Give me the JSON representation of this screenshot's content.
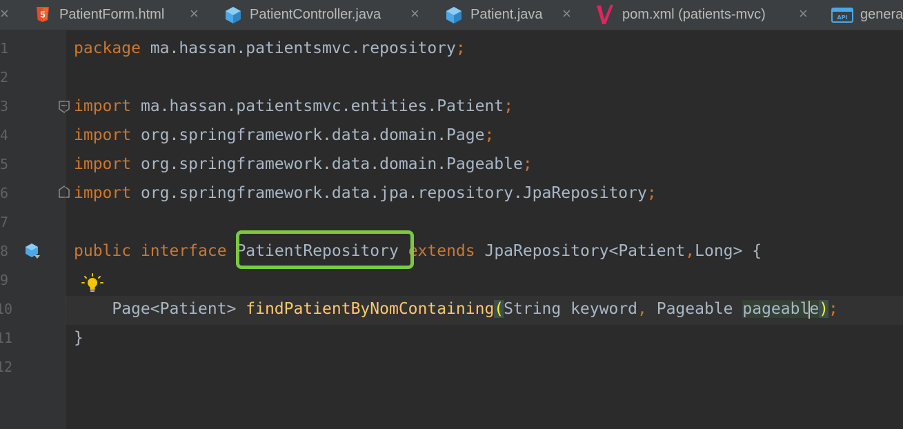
{
  "tabs": [
    {
      "label": "PatientForm.html",
      "icon": "html5-icon",
      "color": "#e44d26"
    },
    {
      "label": "PatientController.java",
      "icon": "java-class-icon",
      "color": "#4aa8e8"
    },
    {
      "label": "Patient.java",
      "icon": "java-class-icon",
      "color": "#4aa8e8"
    },
    {
      "label": "pom.xml (patients-mvc)",
      "icon": "maven-icon",
      "color": "#e0245e"
    },
    {
      "label": "genera",
      "icon": "api-file-icon",
      "color": "#4aa8e8"
    }
  ],
  "editor": {
    "line_numbers": [
      "1",
      "2",
      "3",
      "4",
      "5",
      "6",
      "7",
      "8",
      "9",
      "10",
      "11",
      "12"
    ],
    "code": {
      "l1_kw": "package",
      "l1_rest": " ma.hassan.patientsmvc.repository",
      "l1_semi": ";",
      "l3_kw": "import",
      "l3_rest": " ma.hassan.patientsmvc.entities.Patient",
      "l3_semi": ";",
      "l4_kw": "import",
      "l4_rest": " org.springframework.data.domain.Page",
      "l4_semi": ";",
      "l5_kw": "import",
      "l5_rest": " org.springframework.data.domain.Pageable",
      "l5_semi": ";",
      "l6_kw": "import",
      "l6_rest": " org.springframework.data.jpa.repository.JpaRepository",
      "l6_semi": ";",
      "l8_kw1": "public",
      "l8_kw2": " interface",
      "l8_sp": " ",
      "l8_name": "PatientRepository",
      "l8_kw3": " extends",
      "l8_type": " JpaRepository<Patient",
      "l8_comma": ",",
      "l8_type2": "Long> {",
      "l10_indent": "    ",
      "l10_type": "Page<Patient> ",
      "l10_fn": "findPatientByNomContaining",
      "l10_open": "(",
      "l10_arg1": "String keyword",
      "l10_comma": ",",
      "l10_arg2": " Pageable ",
      "l10_param_a": "pageabl",
      "l10_param_b": "e",
      "l10_close": ")",
      "l10_semi": ";",
      "l11": "}"
    },
    "highlight_color": "#7ac943"
  }
}
